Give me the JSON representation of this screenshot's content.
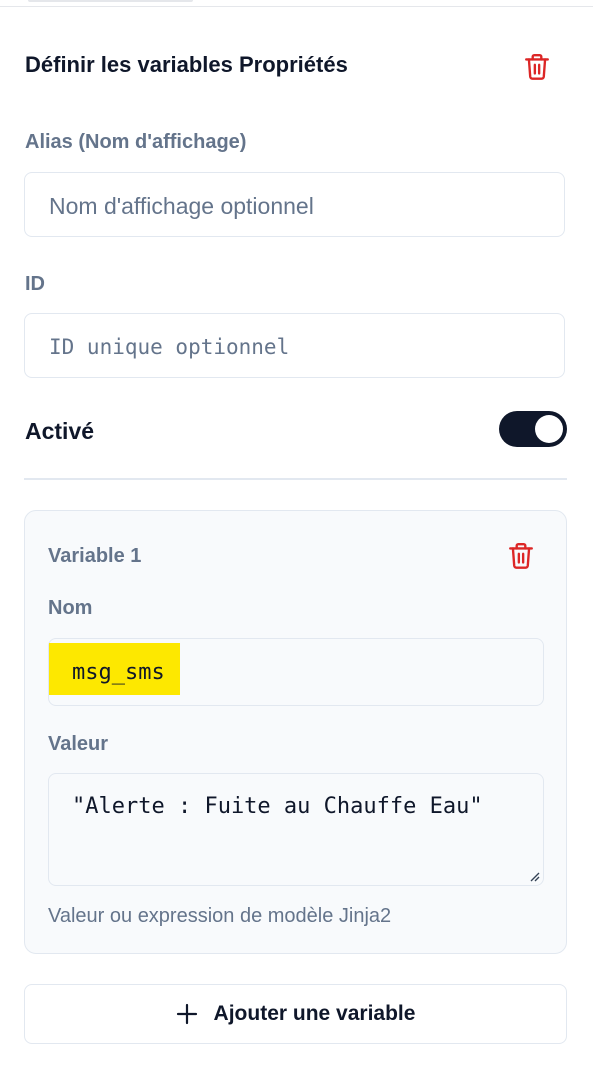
{
  "panel": {
    "title": "Définir les variables Propriétés",
    "delete_icon": "trash-icon"
  },
  "alias": {
    "label": "Alias (Nom d'affichage)",
    "placeholder": "Nom d'affichage optionnel",
    "value": ""
  },
  "id_field": {
    "label": "ID",
    "placeholder": "ID unique optionnel",
    "value": ""
  },
  "enabled": {
    "label": "Activé",
    "value": true
  },
  "variables": [
    {
      "title": "Variable 1",
      "name_label": "Nom",
      "name_value": "msg_sms",
      "value_label": "Valeur",
      "value": "\"Alerte : Fuite au Chauffe Eau\"",
      "hint": "Valeur ou expression de modèle Jinja2"
    }
  ],
  "add_button": {
    "label": "Ajouter une variable",
    "icon": "plus-icon"
  },
  "colors": {
    "danger": "#dc2626",
    "toggle_on": "#0f172a",
    "highlight": "#fde800",
    "muted_text": "#64748b"
  }
}
